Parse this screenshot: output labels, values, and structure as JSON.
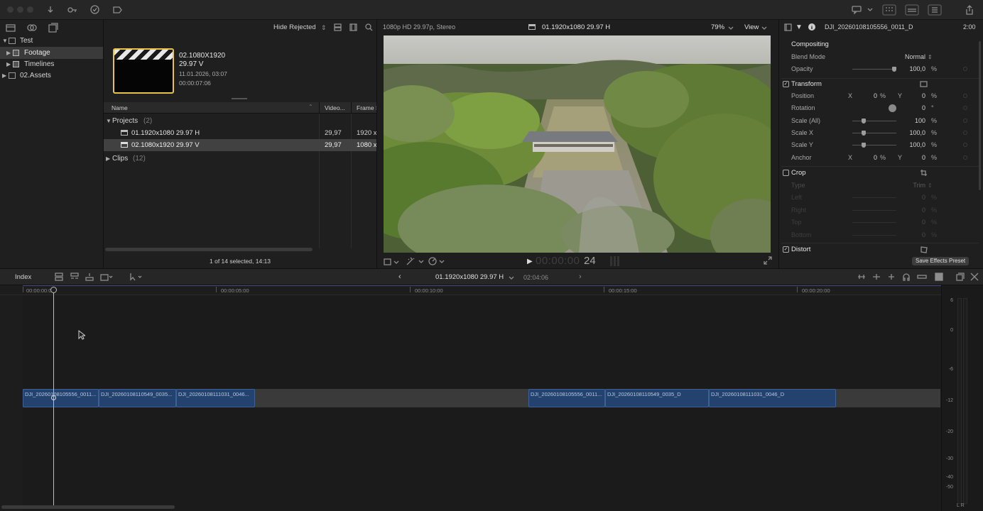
{
  "toolbar": {
    "buttons": [
      "import-icon",
      "key-icon",
      "checkmark-icon",
      "tag-icon"
    ]
  },
  "browser": {
    "libraries": [
      {
        "label": "Test",
        "expanded": true
      },
      {
        "label": "Footage",
        "selected": true
      },
      {
        "label": "Timelines"
      },
      {
        "label": "02.Assets"
      }
    ],
    "filter": "Hide Rejected",
    "thumb": {
      "title": "02.1080X1920",
      "subtitle": "29.97 V",
      "date": "11.01.2026, 03:07",
      "duration": "00:00:07:06"
    },
    "columns": [
      "Name",
      "Video...",
      "Frame S"
    ],
    "groups": [
      {
        "label": "Projects",
        "count": "(2)"
      },
      {
        "label": "Clips",
        "count": "(12)"
      }
    ],
    "items": [
      {
        "name": "01.1920x1080 29.97 H",
        "rate": "29,97",
        "size": "1920 x"
      },
      {
        "name": "02.1080x1920 29.97 V",
        "rate": "29,97",
        "size": "1080 x"
      }
    ],
    "status": "1 of 14 selected, 14:13"
  },
  "viewer": {
    "format": "1080p HD 29.97p, Stereo",
    "project": "01.1920x1080 29.97 H",
    "zoom": "79%",
    "view": "View",
    "timecode": "00:00:00",
    "frame": "24"
  },
  "inspector": {
    "clip_name": "DJI_20260108105556_0011_D",
    "duration": "2:00",
    "compositing": {
      "title": "Compositing",
      "blend_label": "Blend Mode",
      "blend_value": "Normal",
      "opacity_label": "Opacity",
      "opacity_value": "100,0",
      "opacity_unit": "%"
    },
    "transform": {
      "title": "Transform",
      "position": {
        "label": "Position",
        "x_lbl": "X",
        "x": "0",
        "y_lbl": "Y",
        "y": "0",
        "unit": "%"
      },
      "rotation": {
        "label": "Rotation",
        "value": "0",
        "unit": "°"
      },
      "scale_all": {
        "label": "Scale (All)",
        "value": "100",
        "unit": "%"
      },
      "scale_x": {
        "label": "Scale X",
        "value": "100,0",
        "unit": "%"
      },
      "scale_y": {
        "label": "Scale Y",
        "value": "100,0",
        "unit": "%"
      },
      "anchor": {
        "label": "Anchor",
        "x_lbl": "X",
        "x": "0",
        "y_lbl": "Y",
        "y": "0",
        "unit": "%"
      }
    },
    "crop": {
      "title": "Crop",
      "type_label": "Type",
      "type_value": "Trim",
      "rows": [
        {
          "label": "Left",
          "value": "0"
        },
        {
          "label": "Right",
          "value": "0"
        },
        {
          "label": "Top",
          "value": "0"
        },
        {
          "label": "Bottom",
          "value": "0"
        }
      ],
      "unit": "%"
    },
    "distort": {
      "title": "Distort"
    },
    "save_preset": "Save Effects Preset"
  },
  "timeline": {
    "index": "Index",
    "project": "01.1920x1080 29.97 H",
    "duration": "02:04:06",
    "ruler": [
      "00:00:00:00",
      "00:00:05:00",
      "00:00:10:00",
      "00:00:15:00",
      "00:00:20:00"
    ],
    "clips": [
      "DJI_20260108105556_0011...",
      "DJI_20260108110549_0035...",
      "DJI_20260108111031_0046...",
      "DJI_20260108105556_0011...",
      "DJI_20260108110549_0035_D",
      "DJI_20260108111031_0046_D"
    ],
    "meter": [
      "6",
      "0",
      "-6",
      "-12",
      "-20",
      "-30",
      "-40",
      "-50"
    ],
    "meter_footer": "L R"
  }
}
